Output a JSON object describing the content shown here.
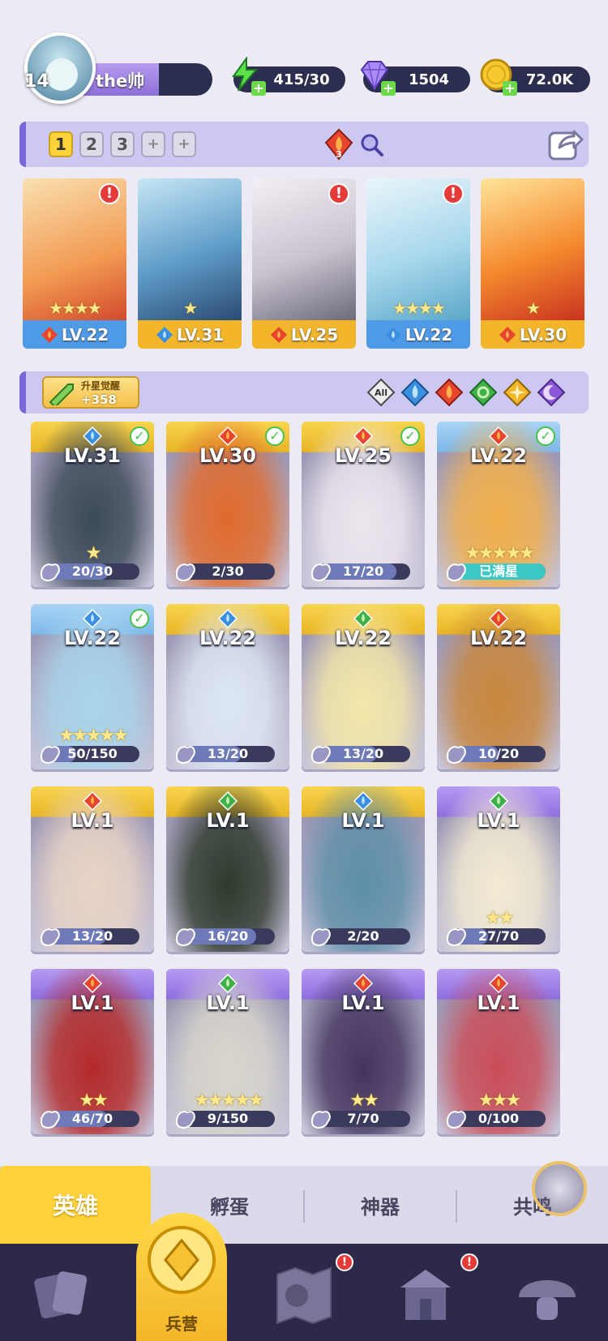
{
  "player": {
    "level": "14",
    "name": "the帅"
  },
  "resources": [
    {
      "icon": "energy-icon",
      "value": "415/30"
    },
    {
      "icon": "gem-icon",
      "value": "1504"
    },
    {
      "icon": "gold-coin-icon",
      "value": "72.0K"
    }
  ],
  "team_slots": [
    "1",
    "2",
    "3",
    "+",
    "+"
  ],
  "active_slot": "1",
  "fire_count": "3",
  "team": [
    {
      "element": "fire",
      "level": "LV.22",
      "stars": 4,
      "alert": true
    },
    {
      "element": "water",
      "level": "LV.31",
      "stars": 1,
      "alert": false
    },
    {
      "element": "fire",
      "level": "LV.25",
      "stars": 0,
      "alert": true
    },
    {
      "element": "water",
      "level": "LV.22",
      "stars": 4,
      "alert": true
    },
    {
      "element": "fire",
      "level": "LV.30",
      "stars": 1,
      "alert": false
    }
  ],
  "awaken": {
    "title": "升星觉醒",
    "count": "+358"
  },
  "filters": [
    "All",
    "water",
    "fire",
    "wind",
    "light",
    "dark"
  ],
  "heroes": [
    {
      "level": "LV.31",
      "element": "water",
      "count": "20/30",
      "progress": 0.67,
      "stars": 1,
      "check": true,
      "frame": "gold"
    },
    {
      "level": "LV.30",
      "element": "fire",
      "count": "2/30",
      "progress": 0.07,
      "stars": 0,
      "check": true,
      "frame": "gold"
    },
    {
      "level": "LV.25",
      "element": "fire",
      "count": "17/20",
      "progress": 0.85,
      "stars": 0,
      "check": true,
      "frame": "gold"
    },
    {
      "level": "LV.22",
      "element": "fire",
      "count": "已满星",
      "progress": 1.0,
      "stars": 5,
      "check": true,
      "frame": "blue"
    },
    {
      "level": "LV.22",
      "element": "water",
      "count": "50/150",
      "progress": 0.33,
      "stars": 5,
      "check": true,
      "frame": "blue"
    },
    {
      "level": "LV.22",
      "element": "water",
      "count": "13/20",
      "progress": 0.65,
      "stars": 0,
      "check": false,
      "frame": "gold"
    },
    {
      "level": "LV.22",
      "element": "wind",
      "count": "13/20",
      "progress": 0.65,
      "stars": 0,
      "check": false,
      "frame": "gold"
    },
    {
      "level": "LV.22",
      "element": "fire",
      "count": "10/20",
      "progress": 0.5,
      "stars": 0,
      "check": false,
      "frame": "gold"
    },
    {
      "level": "LV.1",
      "element": "fire",
      "count": "13/20",
      "progress": 0.65,
      "stars": 0,
      "check": false,
      "frame": "gold"
    },
    {
      "level": "LV.1",
      "element": "wind",
      "count": "16/20",
      "progress": 0.8,
      "stars": 0,
      "check": false,
      "frame": "gold"
    },
    {
      "level": "LV.1",
      "element": "water",
      "count": "2/20",
      "progress": 0.1,
      "stars": 0,
      "check": false,
      "frame": "gold"
    },
    {
      "level": "LV.1",
      "element": "wind",
      "count": "27/70",
      "progress": 0.39,
      "stars": 2,
      "check": false,
      "frame": "purple"
    },
    {
      "level": "LV.1",
      "element": "fire",
      "count": "46/70",
      "progress": 0.66,
      "stars": 2,
      "check": false,
      "frame": "purple"
    },
    {
      "level": "LV.1",
      "element": "wind",
      "count": "9/150",
      "progress": 0.06,
      "stars": 5,
      "check": false,
      "frame": "purple"
    },
    {
      "level": "LV.1",
      "element": "fire",
      "count": "7/70",
      "progress": 0.1,
      "stars": 2,
      "check": false,
      "frame": "purple"
    },
    {
      "level": "LV.1",
      "element": "fire",
      "count": "0/100",
      "progress": 0.0,
      "stars": 3,
      "check": false,
      "frame": "purple"
    }
  ],
  "tabs": [
    "英雄",
    "孵蛋",
    "神器",
    "共鸣"
  ],
  "nav": {
    "active_label": "兵营"
  },
  "colors": {
    "gold_frame": "#F3C43A",
    "blue_frame": "#8EC4F0",
    "purple_frame": "#9A7BE6",
    "fire": "#E8452F",
    "water": "#3A8FE0",
    "wind": "#3FB04A",
    "light": "#F3B62A",
    "dark": "#8B58D9"
  }
}
